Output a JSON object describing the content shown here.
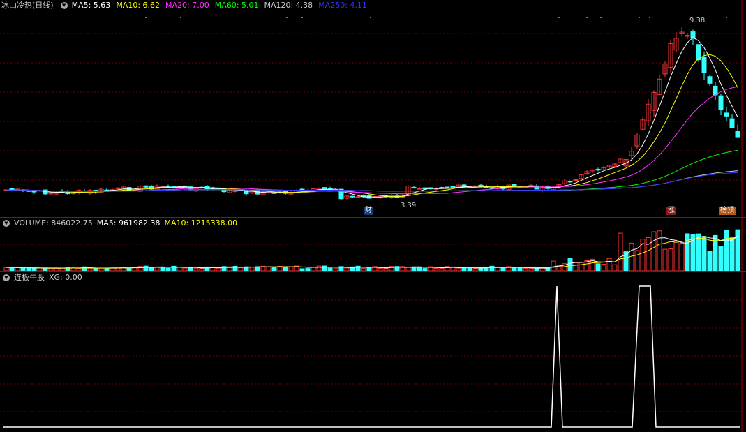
{
  "main": {
    "indicator_name": "冰山冷热(日线)",
    "ma": [
      {
        "label": "MA5: 5.63",
        "color": "#ffffff"
      },
      {
        "label": "MA10: 6.62",
        "color": "#ffff00"
      },
      {
        "label": "MA20: 7.00",
        "color": "#ff33ff"
      },
      {
        "label": "MA60: 5.01",
        "color": "#00ff00"
      },
      {
        "label": "MA120: 4.38",
        "color": "#cccccc"
      },
      {
        "label": "MA250: 4.11",
        "color": "#3333ff"
      }
    ],
    "high_label": "9.38",
    "low_label": "3.39",
    "tag_cai": "财",
    "tag_zhang": "涨",
    "tag_yu": "榜预"
  },
  "volume": {
    "label": "VOLUME: 846022.75",
    "ma5": "MA5: 961982.38",
    "ma10": "MA10: 1215338.00"
  },
  "sub": {
    "name": "连板牛股",
    "xg": "XG: 0.00"
  },
  "colors": {
    "up": "#ff3333",
    "down": "#33ffff",
    "grid": "#7a0000",
    "divider": "#b00000"
  }
}
